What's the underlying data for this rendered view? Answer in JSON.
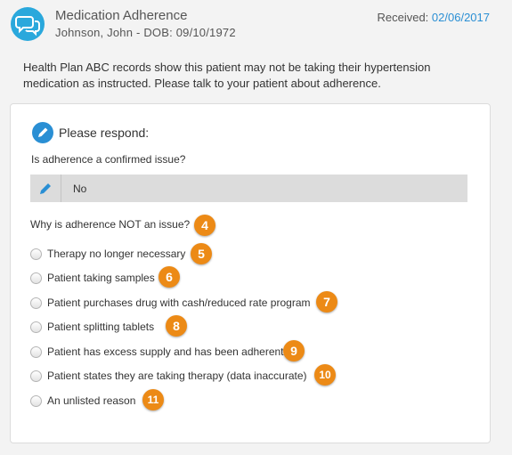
{
  "header": {
    "title": "Medication Adherence",
    "patient": "Johnson, John - DOB: 09/10/1972",
    "received_label": "Received:",
    "received_date": "02/06/2017",
    "icon": "chat-bubbles-icon"
  },
  "message": "Health Plan ABC records show this patient may not be taking their hypertension medication as instructed. Please talk to your patient about adherence.",
  "form": {
    "heading": "Please respond:",
    "question1": "Is adherence a confirmed issue?",
    "answer1": "No",
    "question2": "Why is adherence NOT an issue?",
    "question2_badge": "4",
    "options": [
      {
        "label": "Therapy no longer necessary",
        "badge": "5"
      },
      {
        "label": "Patient taking samples",
        "badge": "6"
      },
      {
        "label": "Patient purchases drug with cash/reduced rate program",
        "badge": "7"
      },
      {
        "label": "Patient splitting tablets",
        "badge": "8"
      },
      {
        "label": "Patient has excess supply and has been adherent",
        "badge": "9"
      },
      {
        "label": "Patient states they are taking therapy (data inaccurate)",
        "badge": "10"
      },
      {
        "label": "An unlisted reason",
        "badge": "11"
      }
    ]
  },
  "colors": {
    "accent_blue": "#2aa8dc",
    "link_blue": "#2a8fd4",
    "badge_orange": "#ec8a16"
  }
}
